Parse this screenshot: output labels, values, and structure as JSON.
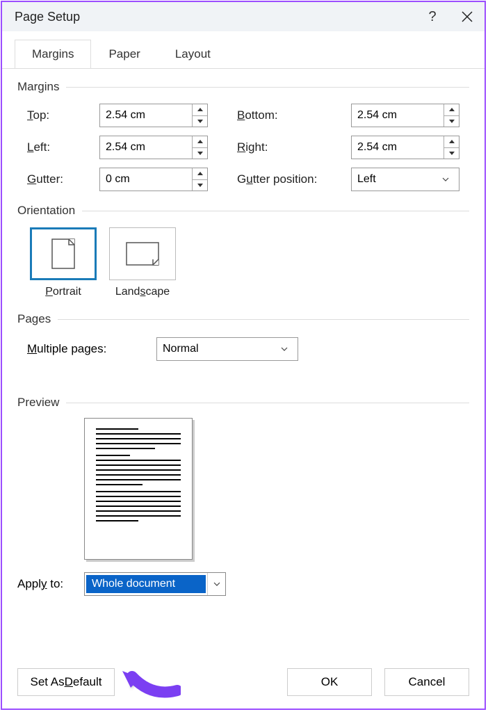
{
  "dialog": {
    "title": "Page Setup"
  },
  "tabs": {
    "margins": "Margins",
    "paper": "Paper",
    "layout": "Layout"
  },
  "sections": {
    "margins": "Margins",
    "orientation": "Orientation",
    "pages": "Pages",
    "preview": "Preview"
  },
  "margins": {
    "top_label": "Top:",
    "top_value": "2.54 cm",
    "bottom_label": "Bottom:",
    "bottom_value": "2.54 cm",
    "left_label": "Left:",
    "left_value": "2.54 cm",
    "right_label": "Right:",
    "right_value": "2.54 cm",
    "gutter_label": "Gutter:",
    "gutter_value": "0 cm",
    "gutter_pos_label": "Gutter position:",
    "gutter_pos_value": "Left"
  },
  "orientation": {
    "portrait": "Portrait",
    "landscape": "Landscape"
  },
  "pages": {
    "multiple_label": "Multiple pages:",
    "multiple_value": "Normal"
  },
  "apply": {
    "label": "Apply to:",
    "value": "Whole document"
  },
  "buttons": {
    "set_default": "Set As Default",
    "ok": "OK",
    "cancel": "Cancel"
  }
}
